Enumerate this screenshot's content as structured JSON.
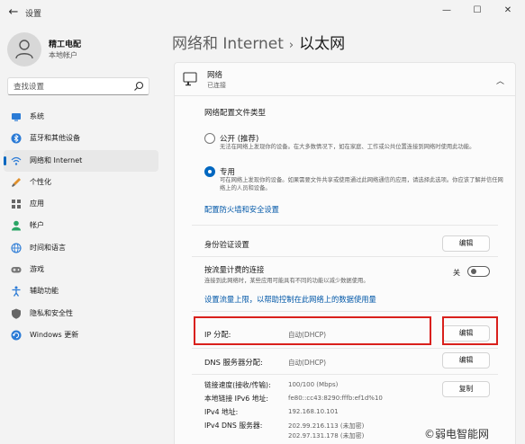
{
  "titlebar": {
    "back": "←",
    "app_title": "设置",
    "minimize": "—",
    "maximize": "☐",
    "close": "✕"
  },
  "profile": {
    "name": "精工电配",
    "account_type": "本地帐户"
  },
  "search": {
    "placeholder": "查找设置"
  },
  "sidebar": {
    "items": [
      {
        "label": "系统",
        "icon": "system-icon"
      },
      {
        "label": "蓝牙和其他设备",
        "icon": "bluetooth-icon"
      },
      {
        "label": "网络和 Internet",
        "icon": "wifi-icon",
        "active": true
      },
      {
        "label": "个性化",
        "icon": "brush-icon"
      },
      {
        "label": "应用",
        "icon": "apps-icon"
      },
      {
        "label": "帐户",
        "icon": "account-icon"
      },
      {
        "label": "时间和语言",
        "icon": "globe-icon"
      },
      {
        "label": "游戏",
        "icon": "gamepad-icon"
      },
      {
        "label": "辅助功能",
        "icon": "accessibility-icon"
      },
      {
        "label": "隐私和安全性",
        "icon": "shield-icon"
      },
      {
        "label": "Windows 更新",
        "icon": "update-icon"
      }
    ]
  },
  "breadcrumb": {
    "parent": "网络和 Internet",
    "separator": "›",
    "current": "以太网"
  },
  "network": {
    "title": "网络",
    "status": "已连接",
    "collapse": "︿"
  },
  "profile_type": {
    "title": "网络配置文件类型",
    "public_label": "公开 (推荐)",
    "public_desc": "无法在网络上发现你的设备。在大多数情况下，如在家庭、工作或公共位置连接到网络时使用此功能。",
    "private_label": "专用",
    "private_desc": "可在网络上发现你的设备。如果需要文件共享或使用通过此网络通信的应用，请选择此选项。你应该了解并信任网络上的人员和设备。",
    "firewall_link": "配置防火墙和安全设置"
  },
  "auth": {
    "label": "身份验证设置",
    "button": "编辑"
  },
  "metered": {
    "label": "按流量计费的连接",
    "desc": "连接到此网络时，某些应用可能具有不同的功能以减少数据使用。",
    "toggle_label": "关",
    "link": "设置流量上限，以帮助控制在此网络上的数据使用量"
  },
  "ip": {
    "label": "IP 分配:",
    "value": "自动(DHCP)",
    "button": "编辑"
  },
  "dns": {
    "label": "DNS 服务器分配:",
    "value": "自动(DHCP)",
    "button": "编辑"
  },
  "info": {
    "copy_button": "复制",
    "rows": [
      {
        "label": "链接速度(接收/传输):",
        "value": "100/100 (Mbps)"
      },
      {
        "label": "本地链接 IPv6 地址:",
        "value": "fe80::cc43:8290:fffb:ef1d%10"
      },
      {
        "label": "IPv4 地址:",
        "value": "192.168.10.101"
      },
      {
        "label": "IPv4 DNS 服务器:",
        "value": "202.99.216.113 (未加密)"
      },
      {
        "label": "",
        "value": "202.97.131.178 (未加密)"
      }
    ]
  },
  "watermark": "©弱电智能网",
  "colors": {
    "accent": "#0067c0",
    "highlight": "#d9201c",
    "link": "#0057a8"
  }
}
